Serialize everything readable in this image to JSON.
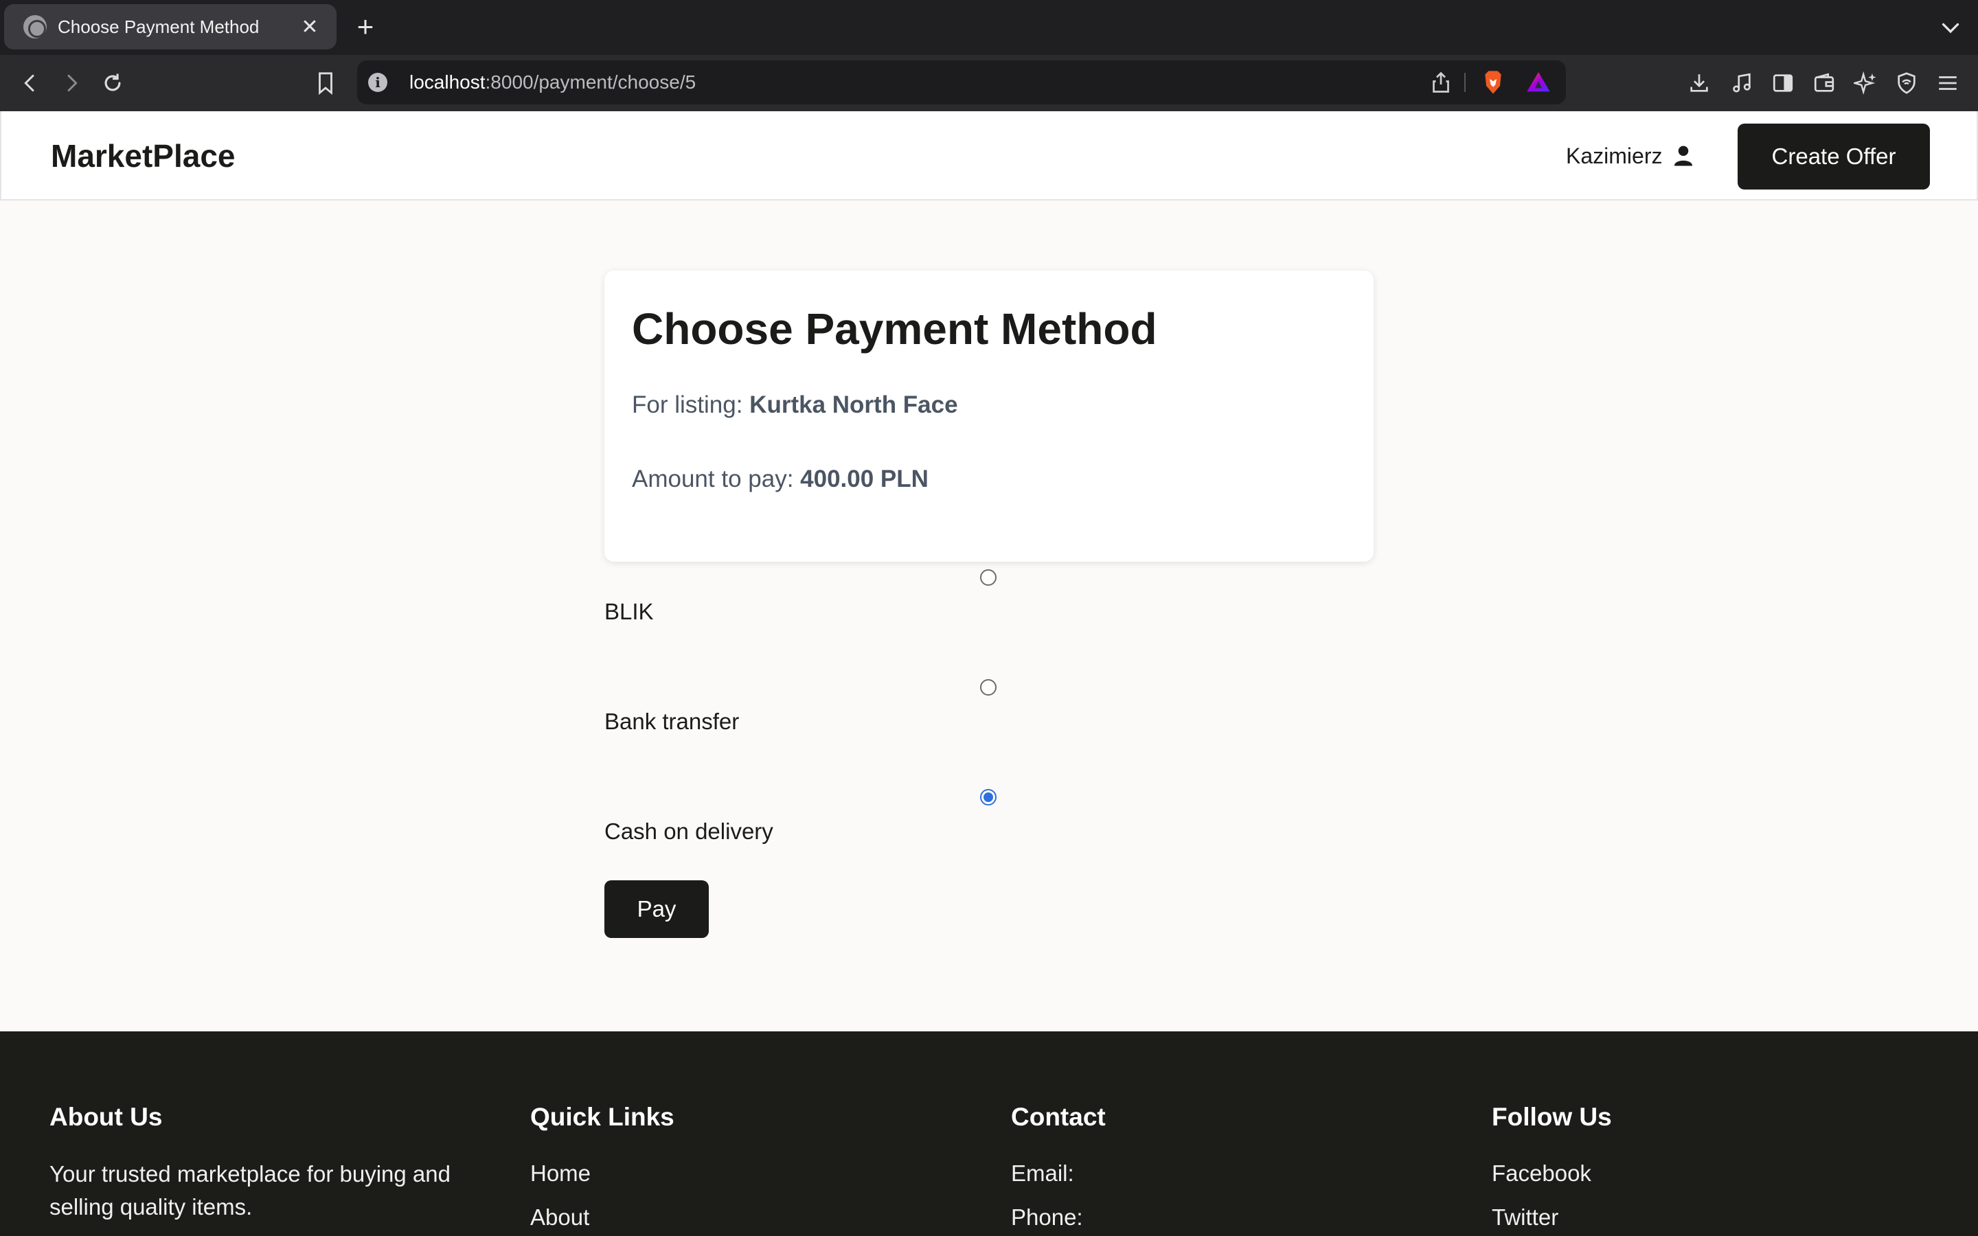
{
  "browser": {
    "tab_title": "Choose Payment Method",
    "url_host": "localhost",
    "url_rest": ":8000/payment/choose/5"
  },
  "header": {
    "brand": "MarketPlace",
    "user_name": "Kazimierz",
    "create_offer_label": "Create Offer"
  },
  "payment": {
    "heading": "Choose Payment Method",
    "listing_prefix": "For listing:",
    "listing_name": "Kurtka North Face",
    "amount_prefix": "Amount to pay:",
    "amount": "400.00 PLN",
    "options": [
      {
        "label": "BLIK",
        "selected": false
      },
      {
        "label": "Bank transfer",
        "selected": false
      },
      {
        "label": "Cash on delivery",
        "selected": true
      }
    ],
    "pay_label": "Pay"
  },
  "footer": {
    "about": {
      "title": "About Us",
      "text": "Your trusted marketplace for buying and selling quality items."
    },
    "quick_links": {
      "title": "Quick Links",
      "items": [
        "Home",
        "About"
      ]
    },
    "contact": {
      "title": "Contact",
      "items": [
        "Email:",
        "Phone:"
      ]
    },
    "follow": {
      "title": "Follow Us",
      "items": [
        "Facebook",
        "Twitter"
      ]
    }
  },
  "colors": {
    "accent": "#1b1b19",
    "radio_selected": "#2d6fe0",
    "footer_bg": "#1c1c19",
    "page_bg": "#fbfaf8"
  }
}
